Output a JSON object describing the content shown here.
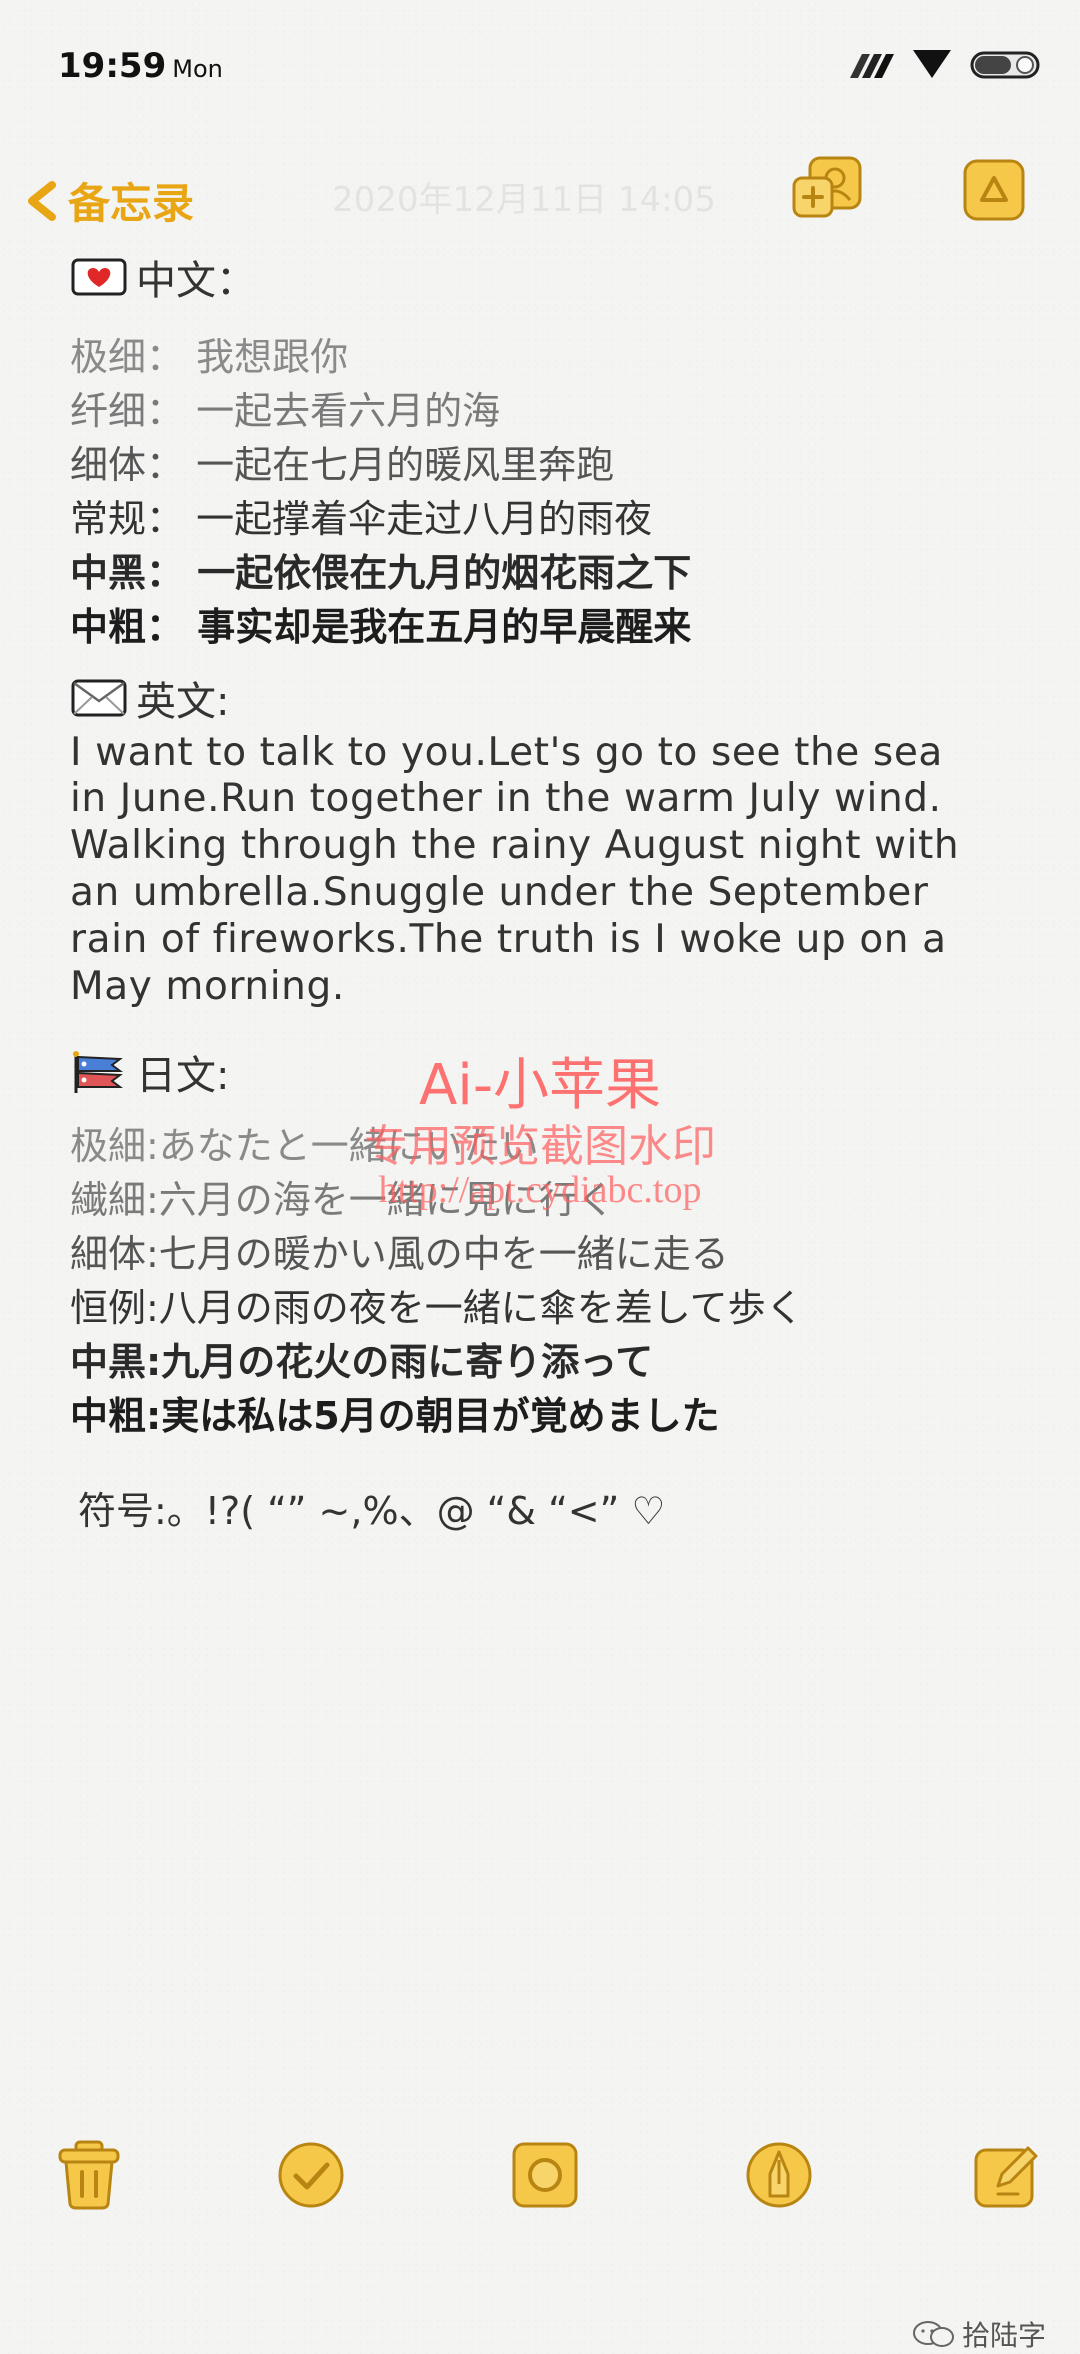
{
  "status_bar": {
    "time": "19:59",
    "day": "Mon"
  },
  "nav": {
    "back_label": "备忘录",
    "note_date": "2020年12月11日 14:05"
  },
  "chinese": {
    "heading": "中文：",
    "lines": [
      "极细：  我想跟你",
      "纤细：  一起去看六月的海",
      "细体：  一起在七月的暖风里奔跑",
      "常规：  一起撑着伞走过八月的雨夜",
      "中黑：  一起依偎在九月的烟花雨之下",
      "中粗：  事实却是我在五月的早晨醒来"
    ]
  },
  "english": {
    "heading": "英文:",
    "lines": [
      "I want to talk to you.Let's go to see the sea",
      "in June.Run together in the warm July wind.",
      "Walking through the rainy August night with",
      "an umbrella.Snuggle under the September",
      "rain of fireworks.The truth is I woke up on a",
      "May morning."
    ]
  },
  "japanese": {
    "heading": "日文:",
    "lines": [
      "极細:あなたと一緒にいたい",
      "繊細:六月の海を一緒に見に行く",
      "細体:七月の暖かい風の中を一緒に走る",
      "恒例:八月の雨の夜を一緒に傘を差して歩く",
      "中黒:九月の花火の雨に寄り添って",
      "中粗:実は私は5月の朝目が覚めました"
    ]
  },
  "symbols": "符号:。!?( “” ~,%、@ “& “<” ♡",
  "watermark": {
    "line1": "Ai-小苹果",
    "line2": "专用预览截图水印",
    "line3": "http://apt.cydiabc.top"
  },
  "footer": {
    "wechat_label": "拾陆字"
  },
  "colors": {
    "accent": "#e8a514",
    "accent_light": "#f5c84a",
    "watermark": "#ff4b4b"
  },
  "icons": [
    "back-chevron-icon",
    "share-icon",
    "menu-icon",
    "trash-icon",
    "checklist-icon",
    "camera-icon",
    "pen-icon",
    "compose-icon"
  ]
}
